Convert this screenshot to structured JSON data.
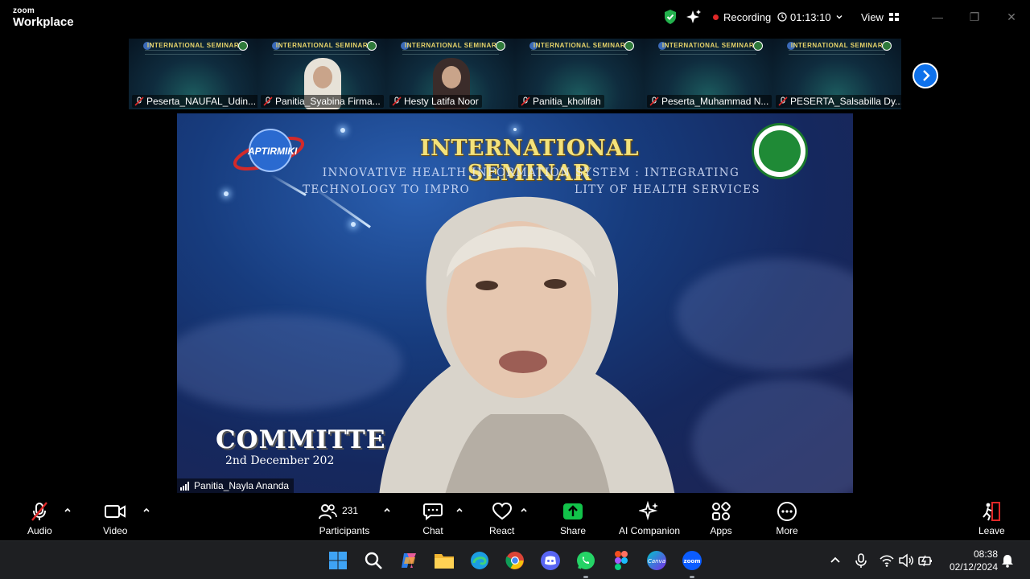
{
  "app": {
    "brand_top": "zoom",
    "brand_bottom": "Workplace"
  },
  "titlebar": {
    "security_icon": "shield-check-icon",
    "ai_icon": "sparkle-icon",
    "recording_label": "Recording",
    "timer": "01:13:10",
    "view_label": "View"
  },
  "gallery": {
    "thumbnail_title": "INTERNATIONAL SEMINAR",
    "participants": [
      {
        "name": "Peserta_NAUFAL_Udin...",
        "muted": true,
        "video": false
      },
      {
        "name": "Panitia_Syabina Firma...",
        "muted": true,
        "video": true
      },
      {
        "name": "Hesty Latifa Noor",
        "muted": true,
        "video": true
      },
      {
        "name": "Panitia_kholifah",
        "muted": true,
        "video": false
      },
      {
        "name": "Peserta_Muhammad N...",
        "muted": true,
        "video": false
      },
      {
        "name": "PESERTA_Salsabilla Dy...",
        "muted": true,
        "video": false
      }
    ]
  },
  "main_video": {
    "title": "INTERNATIONAL SEMINAR",
    "subtitle_line1": "INNOVATIVE HEALTH INFORMATION SYSTEM : INTEGRATING",
    "subtitle_line2": "TECHNOLOGY TO IMPRO",
    "subtitle_line2_end": "LITY OF HEALTH SERVICES",
    "logo_left_text": "APTIRMIKI",
    "committee_text": "COMMITTE",
    "date_text": "2nd December 202",
    "speaker_name": "Panitia_Nayla Ananda"
  },
  "controls": {
    "audio": "Audio",
    "video": "Video",
    "participants": "Participants",
    "participant_count": "231",
    "chat": "Chat",
    "react": "React",
    "share": "Share",
    "ai_companion": "AI Companion",
    "apps": "Apps",
    "more": "More",
    "leave": "Leave"
  },
  "taskbar": {
    "time": "08:38",
    "date": "02/12/2024",
    "apps": [
      "windows-start",
      "search",
      "copilot",
      "file-explorer",
      "edge",
      "chrome",
      "discord",
      "whatsapp",
      "figma",
      "canva",
      "zoom"
    ]
  },
  "colors": {
    "accent_blue": "#0e71eb",
    "share_green": "#12c24a",
    "recording_red": "#e02828",
    "title_gold": "#f4e27a"
  }
}
